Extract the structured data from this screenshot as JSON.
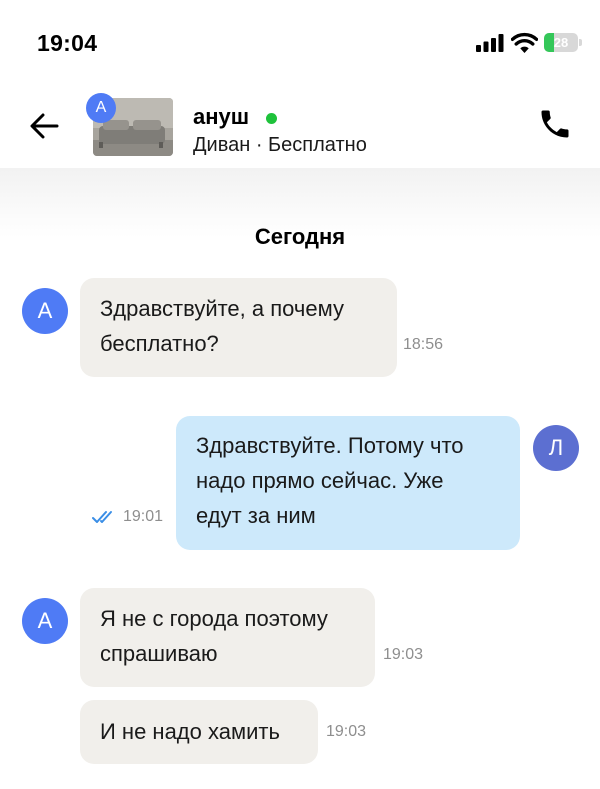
{
  "status_bar": {
    "time": "19:04",
    "battery_level": "28",
    "battery_fraction": 0.28,
    "icons": [
      "signal-icon",
      "wifi-icon",
      "battery-charging-icon"
    ]
  },
  "header": {
    "back_icon": "arrow-left-icon",
    "avatar_letter": "А",
    "contact_name": "ануш",
    "online": true,
    "listing_info": "Диван · Бесплатно",
    "call_icon": "phone-icon",
    "colors": {
      "online": "#1ec23b",
      "avatar": "#4f7bf5"
    }
  },
  "chat": {
    "date_label": "Сегодня",
    "messages": [
      {
        "direction": "incoming",
        "avatar": "А",
        "lines": [
          "Здравствуйте, а почему",
          "бесплатно?"
        ],
        "time": "18:56"
      },
      {
        "direction": "outgoing",
        "avatar": "Л",
        "lines": [
          "Здравствуйте. Потому что",
          "надо прямо сейчас. Уже",
          "едут за ним"
        ],
        "time": "19:01",
        "status": "read"
      },
      {
        "direction": "incoming",
        "avatar": "А",
        "lines": [
          "Я не с города поэтому",
          "спрашиваю"
        ],
        "time": "19:03"
      },
      {
        "direction": "incoming",
        "lines": [
          "И не надо хамить"
        ],
        "time": "19:03"
      }
    ],
    "colors": {
      "incoming_bubble": "#f1efeb",
      "outgoing_bubble": "#cde9fb",
      "read_check": "#3a8ee6"
    }
  }
}
